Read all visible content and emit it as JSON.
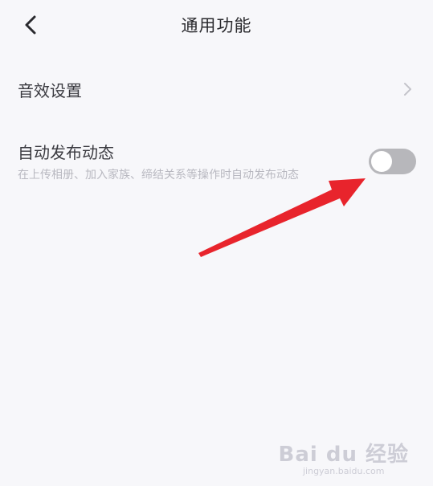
{
  "header": {
    "title": "通用功能",
    "back_icon": "chevron-left-icon"
  },
  "sound_settings": {
    "label": "音效设置",
    "icon": "chevron-right-icon"
  },
  "auto_post": {
    "label": "自动发布动态",
    "description": "在上传相册、加入家族、缔结关系等操作时自动发布动态",
    "toggle_on": false
  },
  "watermark": {
    "logo": "Bai du 经验",
    "sub": "jingyan.baidu.com"
  },
  "colors": {
    "background": "#f7f7fa",
    "toggle_off": "#b7b7bb",
    "arrow": "#e8242c"
  }
}
